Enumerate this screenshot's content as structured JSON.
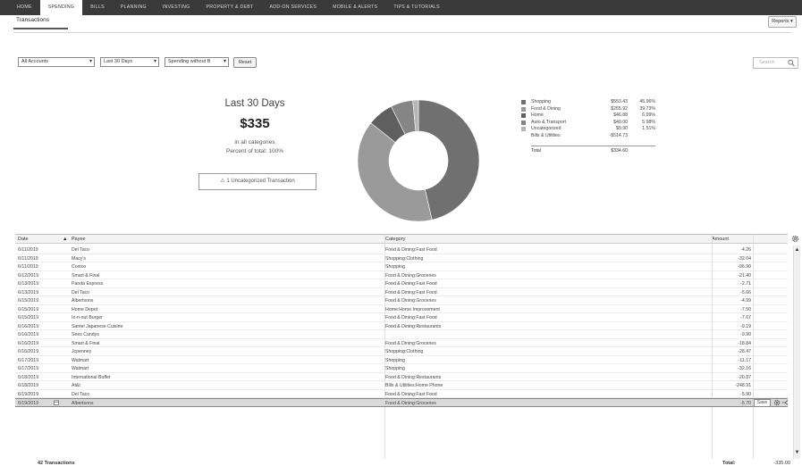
{
  "nav": {
    "items": [
      "HOME",
      "SPENDING",
      "BILLS",
      "PLANNING",
      "INVESTING",
      "PROPERTY & DEBT",
      "ADD-ON SERVICES",
      "MOBILE & ALERTS",
      "TIPS & TUTORIALS"
    ],
    "active_index": 1
  },
  "tab": {
    "label": "Transactions"
  },
  "reports": {
    "label": "Reports"
  },
  "filters": {
    "account": "All Accounts",
    "period": "Last 30 Days",
    "view": "Spending without B",
    "reset_label": "Reset",
    "search_placeholder": "Search"
  },
  "summary": {
    "period": "Last 30 Days",
    "amount": "$335",
    "scope": "in all categories",
    "percent": "Percent of total: 100%",
    "uncategorized": "1 Uncategorized Transaction"
  },
  "chart_data": {
    "type": "pie",
    "donut": true,
    "categories": [
      "Shopping",
      "Food & Dining",
      "Home",
      "Auto & Transport",
      "Uncategorized",
      "Bills & Utilities"
    ],
    "amounts": [
      "$553.43",
      "$265.92",
      "$46.88",
      "$40.00",
      "$9.90",
      "-$514.73"
    ],
    "percents": [
      "46.96%",
      "39.73%",
      "6.99%",
      "5.98%",
      "1.51%",
      ""
    ],
    "values": [
      46.96,
      39.73,
      6.99,
      5.98,
      1.51
    ],
    "colors": [
      "#707070",
      "#9a9a9a",
      "#5f5f5f",
      "#858585",
      "#b5b5b5",
      "#ffffff"
    ],
    "total_label": "Total",
    "total_amount": "$334.60"
  },
  "grid": {
    "headers": {
      "date": "Date",
      "payee": "Payee",
      "category": "Category",
      "amount": "Amount"
    },
    "rows": [
      {
        "date": "6/11/2019",
        "payee": "Del Taco",
        "category": "Food & Dining:Fast Food",
        "amount": "-4.26"
      },
      {
        "date": "6/11/2019",
        "payee": "Macy's",
        "category": "Shopping:Clothing",
        "amount": "-32.04"
      },
      {
        "date": "6/11/2019",
        "payee": "Costco",
        "category": "Shopping",
        "amount": "-96.90"
      },
      {
        "date": "6/12/2019",
        "payee": "Smart & Final",
        "category": "Food & Dining:Groceries",
        "amount": "-21.40"
      },
      {
        "date": "6/13/2019",
        "payee": "Panda Express",
        "category": "Food & Dining:Fast Food",
        "amount": "-2.71"
      },
      {
        "date": "6/13/2019",
        "payee": "Del Taco",
        "category": "Food & Dining:Fast Food",
        "amount": "-5.66"
      },
      {
        "date": "6/15/2019",
        "payee": "Albertsons",
        "category": "Food & Dining:Groceries",
        "amount": "-4.99"
      },
      {
        "date": "6/15/2019",
        "payee": "Home Depot",
        "category": "Home:Home Improvement",
        "amount": "-7.50"
      },
      {
        "date": "6/15/2019",
        "payee": "In-n-out Burger",
        "category": "Food & Dining:Fast Food",
        "amount": "-7.67"
      },
      {
        "date": "6/16/2019",
        "payee": "Santei Japanese Cuisine",
        "category": "Food & Dining:Restaurants",
        "amount": "-9.19"
      },
      {
        "date": "6/16/2019",
        "payee": "Sees Candys",
        "category": "",
        "amount": "-9.90"
      },
      {
        "date": "6/16/2019",
        "payee": "Smart & Final",
        "category": "Food & Dining:Groceries",
        "amount": "-18.84"
      },
      {
        "date": "6/16/2019",
        "payee": "Jcpenney",
        "category": "Shopping:Clothing",
        "amount": "-28.47"
      },
      {
        "date": "6/17/2019",
        "payee": "Walmart",
        "category": "Shopping",
        "amount": "-11.17"
      },
      {
        "date": "6/17/2019",
        "payee": "Walmart",
        "category": "Shopping",
        "amount": "-32.16"
      },
      {
        "date": "6/18/2019",
        "payee": "International Buffet",
        "category": "Food & Dining:Restaurants",
        "amount": "-20.87"
      },
      {
        "date": "6/18/2019",
        "payee": "At&t",
        "category": "Bills & Utilities:Home Phone",
        "amount": "-248.91"
      },
      {
        "date": "6/19/2019",
        "payee": "Del Taco",
        "category": "Food & Dining:Fast Food",
        "amount": "-5.90"
      },
      {
        "date": "6/19/2019",
        "payee": "Albertsons",
        "category": "Food & Dining:Groceries",
        "amount": "-5.70"
      }
    ],
    "save_label": "Save"
  },
  "footer": {
    "count": "42 Transactions",
    "total_label": "Total:",
    "total": "-335.00"
  }
}
